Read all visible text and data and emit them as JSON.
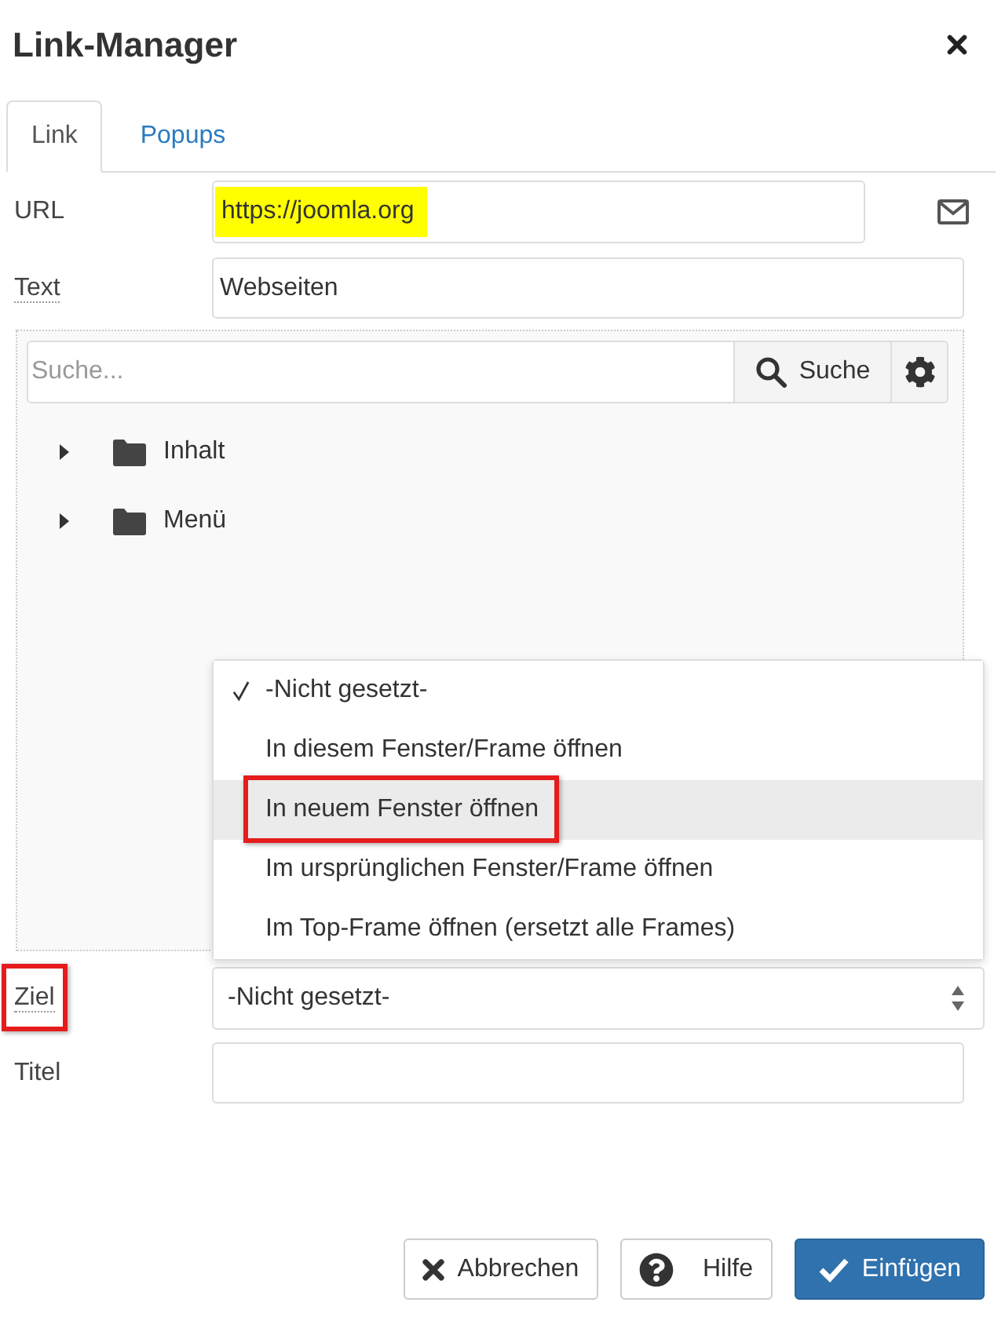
{
  "dialog": {
    "title": "Link-Manager"
  },
  "tabs": [
    {
      "label": "Link",
      "selected": true
    },
    {
      "label": "Popups",
      "selected": false
    }
  ],
  "url": {
    "label": "URL",
    "value": "https://joomla.org",
    "highlighted": true
  },
  "text": {
    "label": "Text",
    "value": "Webseiten",
    "tooltip": true
  },
  "browser": {
    "search": {
      "placeholder": "Suche...",
      "button": "Suche"
    },
    "tree": [
      {
        "label": "Inhalt",
        "expanded": false
      },
      {
        "label": "Menü",
        "expanded": false
      }
    ]
  },
  "target": {
    "label": "Ziel",
    "tooltip": true,
    "annotated": true,
    "value": "-Nicht gesetzt-",
    "expanded": true,
    "options": [
      {
        "label": "-Nicht gesetzt-",
        "selected": true,
        "highlighted": false,
        "annotated": false
      },
      {
        "label": "In diesem Fenster/Frame öffnen",
        "selected": false,
        "highlighted": false,
        "annotated": false
      },
      {
        "label": "In neuem Fenster öffnen",
        "selected": false,
        "highlighted": true,
        "annotated": true
      },
      {
        "label": "Im ursprünglichen Fenster/Frame öffnen",
        "selected": false,
        "highlighted": false,
        "annotated": false
      },
      {
        "label": "Im Top-Frame öffnen (ersetzt alle Frames)",
        "selected": false,
        "highlighted": false,
        "annotated": false
      }
    ]
  },
  "title": {
    "label": "Titel"
  },
  "buttons": [
    {
      "kind": "cancel",
      "label": "Abbrechen"
    },
    {
      "kind": "help",
      "label": "Hilfe"
    },
    {
      "kind": "insert",
      "label": "Einfügen"
    }
  ]
}
